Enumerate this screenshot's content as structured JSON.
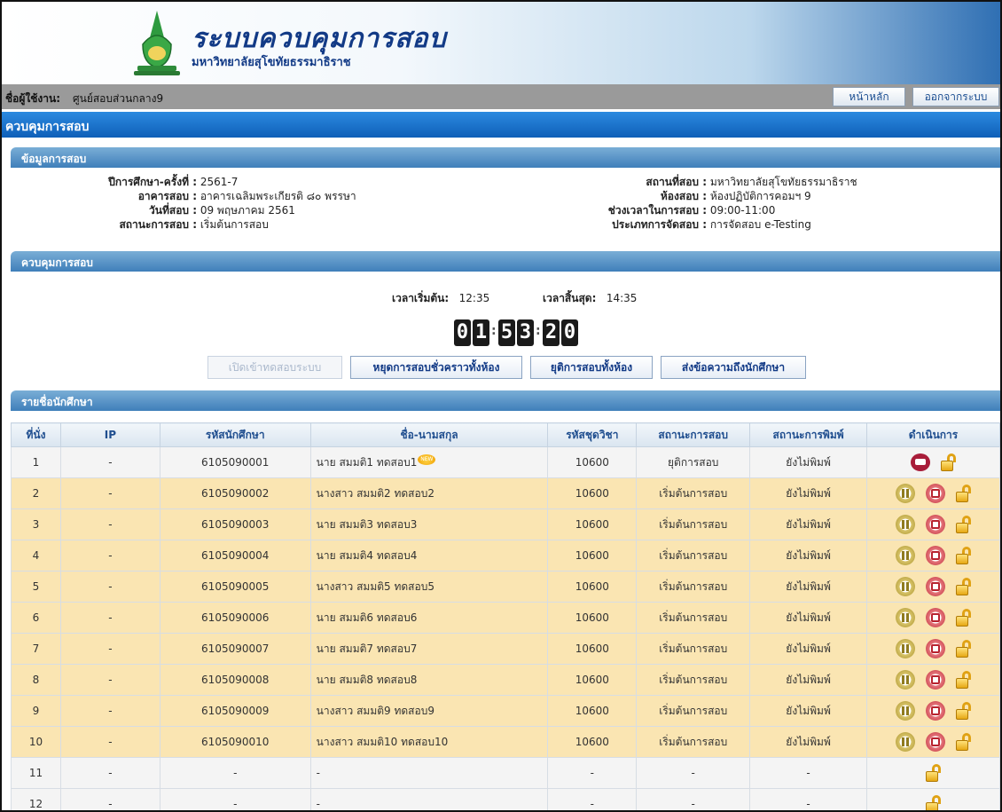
{
  "header": {
    "title": "ระบบควบคุมการสอบ",
    "subtitle": "มหาวิทยาลัยสุโขทัยธรรมาธิราช"
  },
  "userbar": {
    "label": "ชื่อผู้ใช้งาน:",
    "value": "ศูนย์สอบส่วนกลาง9",
    "home_button": "หน้าหลัก",
    "logout_button": "ออกจากระบบ"
  },
  "page_title": "ควบคุมการสอบ",
  "exam_info": {
    "section_title": "ข้อมูลการสอบ",
    "left": [
      {
        "label": "ปีการศึกษา-ครั้งที่ :",
        "value": "2561-7"
      },
      {
        "label": "อาคารสอบ :",
        "value": "อาคารเฉลิมพระเกียรติ ๘๐ พรรษา"
      },
      {
        "label": "วันที่สอบ :",
        "value": "09 พฤษภาคม 2561"
      },
      {
        "label": "สถานะการสอบ :",
        "value": "เริ่มต้นการสอบ"
      }
    ],
    "right": [
      {
        "label": "สถานที่สอบ :",
        "value": "มหาวิทยาลัยสุโขทัยธรรมาธิราช"
      },
      {
        "label": "ห้องสอบ :",
        "value": "ห้องปฏิบัติการคอมฯ 9"
      },
      {
        "label": "ช่วงเวลาในการสอบ :",
        "value": "09:00-11:00"
      },
      {
        "label": "ประเภทการจัดสอบ :",
        "value": "การจัดสอบ e-Testing"
      }
    ]
  },
  "control": {
    "section_title": "ควบคุมการสอบ",
    "start_label": "เวลาเริ่มต้น:",
    "start_value": "12:35",
    "end_label": "เวลาสิ้นสุด:",
    "end_value": "14:35",
    "countdown": [
      "0",
      "1",
      "5",
      "3",
      "2",
      "0"
    ],
    "buttons": {
      "open_test": "เปิดเข้าทดสอบระบบ",
      "pause_all": "หยุดการสอบชั่วคราวทั้งห้อง",
      "end_all": "ยุติการสอบทั้งห้อง",
      "send_message": "ส่งข้อความถึงนักศึกษา"
    }
  },
  "students": {
    "section_title": "รายชื่อนักศึกษา",
    "columns": [
      "ที่นั่ง",
      "IP",
      "รหัสนักศึกษา",
      "ชื่อ-นามสกุล",
      "รหัสชุดวิชา",
      "สถานะการสอบ",
      "สถานะการพิมพ์",
      "ดำเนินการ"
    ],
    "new_badge": "NEW",
    "rows": [
      {
        "seat": "1",
        "ip": "-",
        "id": "6105090001",
        "name": "นาย สมมติ1 ทดสอบ1",
        "course": "10600",
        "status": "ยุติการสอบ",
        "print": "ยังไม่พิมพ์",
        "actions": [
          "print",
          "lock"
        ],
        "new": true
      },
      {
        "seat": "2",
        "ip": "-",
        "id": "6105090002",
        "name": "นางสาว สมมติ2 ทดสอบ2",
        "course": "10600",
        "status": "เริ่มต้นการสอบ",
        "print": "ยังไม่พิมพ์",
        "actions": [
          "pause",
          "stop",
          "lock"
        ]
      },
      {
        "seat": "3",
        "ip": "-",
        "id": "6105090003",
        "name": "นาย สมมติ3 ทดสอบ3",
        "course": "10600",
        "status": "เริ่มต้นการสอบ",
        "print": "ยังไม่พิมพ์",
        "actions": [
          "pause",
          "stop",
          "lock"
        ]
      },
      {
        "seat": "4",
        "ip": "-",
        "id": "6105090004",
        "name": "นาย สมมติ4 ทดสอบ4",
        "course": "10600",
        "status": "เริ่มต้นการสอบ",
        "print": "ยังไม่พิมพ์",
        "actions": [
          "pause",
          "stop",
          "lock"
        ]
      },
      {
        "seat": "5",
        "ip": "-",
        "id": "6105090005",
        "name": "นางสาว สมมติ5 ทดสอบ5",
        "course": "10600",
        "status": "เริ่มต้นการสอบ",
        "print": "ยังไม่พิมพ์",
        "actions": [
          "pause",
          "stop",
          "lock"
        ]
      },
      {
        "seat": "6",
        "ip": "-",
        "id": "6105090006",
        "name": "นาย สมมติ6 ทดสอบ6",
        "course": "10600",
        "status": "เริ่มต้นการสอบ",
        "print": "ยังไม่พิมพ์",
        "actions": [
          "pause",
          "stop",
          "lock"
        ]
      },
      {
        "seat": "7",
        "ip": "-",
        "id": "6105090007",
        "name": "นาย สมมติ7 ทดสอบ7",
        "course": "10600",
        "status": "เริ่มต้นการสอบ",
        "print": "ยังไม่พิมพ์",
        "actions": [
          "pause",
          "stop",
          "lock"
        ]
      },
      {
        "seat": "8",
        "ip": "-",
        "id": "6105090008",
        "name": "นาย สมมติ8 ทดสอบ8",
        "course": "10600",
        "status": "เริ่มต้นการสอบ",
        "print": "ยังไม่พิมพ์",
        "actions": [
          "pause",
          "stop",
          "lock"
        ]
      },
      {
        "seat": "9",
        "ip": "-",
        "id": "6105090009",
        "name": "นางสาว สมมติ9 ทดสอบ9",
        "course": "10600",
        "status": "เริ่มต้นการสอบ",
        "print": "ยังไม่พิมพ์",
        "actions": [
          "pause",
          "stop",
          "lock"
        ]
      },
      {
        "seat": "10",
        "ip": "-",
        "id": "6105090010",
        "name": "นางสาว สมมติ10 ทดสอบ10",
        "course": "10600",
        "status": "เริ่มต้นการสอบ",
        "print": "ยังไม่พิมพ์",
        "actions": [
          "pause",
          "stop",
          "lock"
        ]
      },
      {
        "seat": "11",
        "ip": "-",
        "id": "-",
        "name": "-",
        "course": "-",
        "status": "-",
        "print": "-",
        "actions": [
          "lock"
        ]
      },
      {
        "seat": "12",
        "ip": "-",
        "id": "-",
        "name": "-",
        "course": "-",
        "status": "-",
        "print": "-",
        "actions": [
          "lock"
        ]
      }
    ]
  },
  "colors": {
    "brand_blue": "#123a86",
    "bar_blue": "#0f5fb8",
    "section_blue": "#3f7fba",
    "row_highlight": "#fae5b2",
    "row_normal": "#f4f4f4"
  }
}
